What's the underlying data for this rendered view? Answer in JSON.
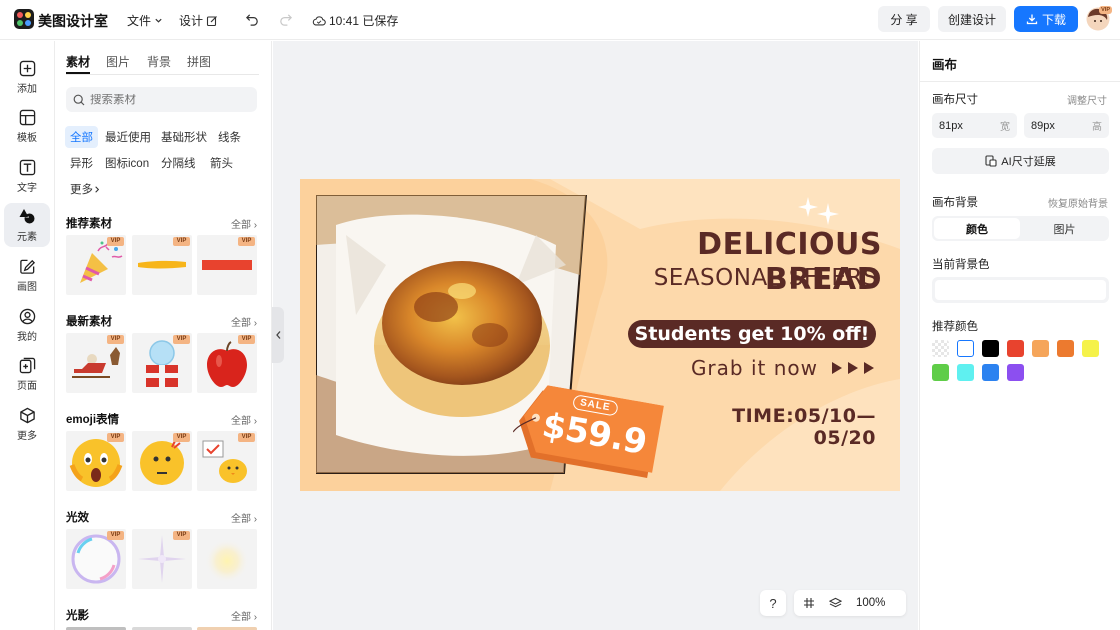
{
  "topbar": {
    "app_name": "美图设计室",
    "file_menu": "文件",
    "design_menu": "设计",
    "save_status": "10:41 已保存",
    "share_label": "分 享",
    "create_label": "创建设计",
    "download_label": "下载",
    "avatar_badge": "VIP"
  },
  "rail": {
    "items": [
      {
        "label": "添加",
        "icon": "plus-square-icon"
      },
      {
        "label": "模板",
        "icon": "template-icon"
      },
      {
        "label": "文字",
        "icon": "text-icon"
      },
      {
        "label": "元素",
        "icon": "shapes-icon"
      },
      {
        "label": "画图",
        "icon": "draw-icon"
      },
      {
        "label": "我的",
        "icon": "user-icon"
      },
      {
        "label": "页面",
        "icon": "page-add-icon"
      },
      {
        "label": "更多",
        "icon": "cube-icon"
      }
    ]
  },
  "panel": {
    "tabs": [
      "素材",
      "图片",
      "背景",
      "拼图"
    ],
    "search_placeholder": "搜索素材",
    "filters": [
      "全部",
      "最近使用",
      "基础形状",
      "线条",
      "异形",
      "图标icon",
      "分隔线",
      "箭头",
      "更多"
    ],
    "all_label": "全部",
    "vip": "VIP",
    "sections": [
      {
        "title": "推荐素材"
      },
      {
        "title": "最新素材"
      },
      {
        "title": "emoji表情"
      },
      {
        "title": "光效"
      },
      {
        "title": "光影"
      }
    ]
  },
  "banner": {
    "title": "DELICIOUS BREAD",
    "subtitle": "SEASONAL SFFERS",
    "promo": "Students get 10% off!",
    "cta": "Grab it now",
    "tag_label": "SALE",
    "price": "$59.9",
    "time": "TIME:05/10—05/20"
  },
  "canvas_tools": {
    "help": "?",
    "zoom": "100%"
  },
  "right": {
    "title": "画布",
    "size_label": "画布尺寸",
    "adjust_size": "调整尺寸",
    "width_value": "81px",
    "width_unit": "宽",
    "height_value": "89px",
    "height_unit": "高",
    "ai_extend": "AI尺寸延展",
    "bg_label": "画布背景",
    "restore_bg": "恢复原始背景",
    "bg_tab_color": "颜色",
    "bg_tab_image": "图片",
    "current_bg": "当前背景色",
    "recommended": "推荐颜色",
    "swatches": [
      "transparent",
      "#ffffff",
      "#000000",
      "#e8432e",
      "#f5a55a",
      "#ec7a2f",
      "#f5f24a",
      "#5fcd48",
      "#5ff0f0",
      "#2c82f0",
      "#8c4ff0"
    ]
  },
  "colors": {
    "accent": "#1677ff",
    "banner_bg": "#fdd9ab",
    "banner_text": "#5a2a25",
    "price_tag": "#f5873a"
  }
}
